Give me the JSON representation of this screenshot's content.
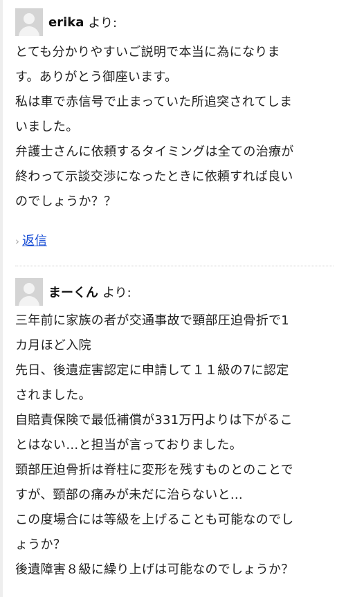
{
  "comments": [
    {
      "author": "erika",
      "says": "より:",
      "lines": [
        "とても分かりやすいご説明で本当に為になりま",
        "す。ありがとう御座います。",
        "私は車で赤信号で止まっていた所追突されてしま",
        "いました。",
        "弁護士さんに依頼するタイミングは全ての治療が",
        "終わって示談交渉になったときに依頼すれば良い",
        "のでしょうか？？"
      ],
      "reply_label": "返信"
    },
    {
      "author": "まーくん",
      "says": "より:",
      "lines": [
        "三年前に家族の者が交通事故で頸部圧迫骨折で1",
        "カ月ほど入院",
        "先日、後遺症害認定に申請して１１級の7に認定",
        "されました。",
        "自賠責保険で最低補償が331万円よりは下がるこ",
        "とはない…と担当が言っておりました。",
        "頸部圧迫骨折は脊柱に変形を残すものとのことで",
        "すが、頸部の痛みが未だに治らないと…",
        "この度場合には等級を上げることも可能なのでし",
        "ょうか？",
        "後遺障害８級に繰り上げは可能なのでしょうか？"
      ]
    }
  ],
  "icons": {
    "avatar": "default-avatar-icon",
    "reply_chevron": "chevron-right-icon"
  },
  "colors": {
    "link": "#1a4fd6",
    "avatar_bg": "#d4d4d4"
  }
}
